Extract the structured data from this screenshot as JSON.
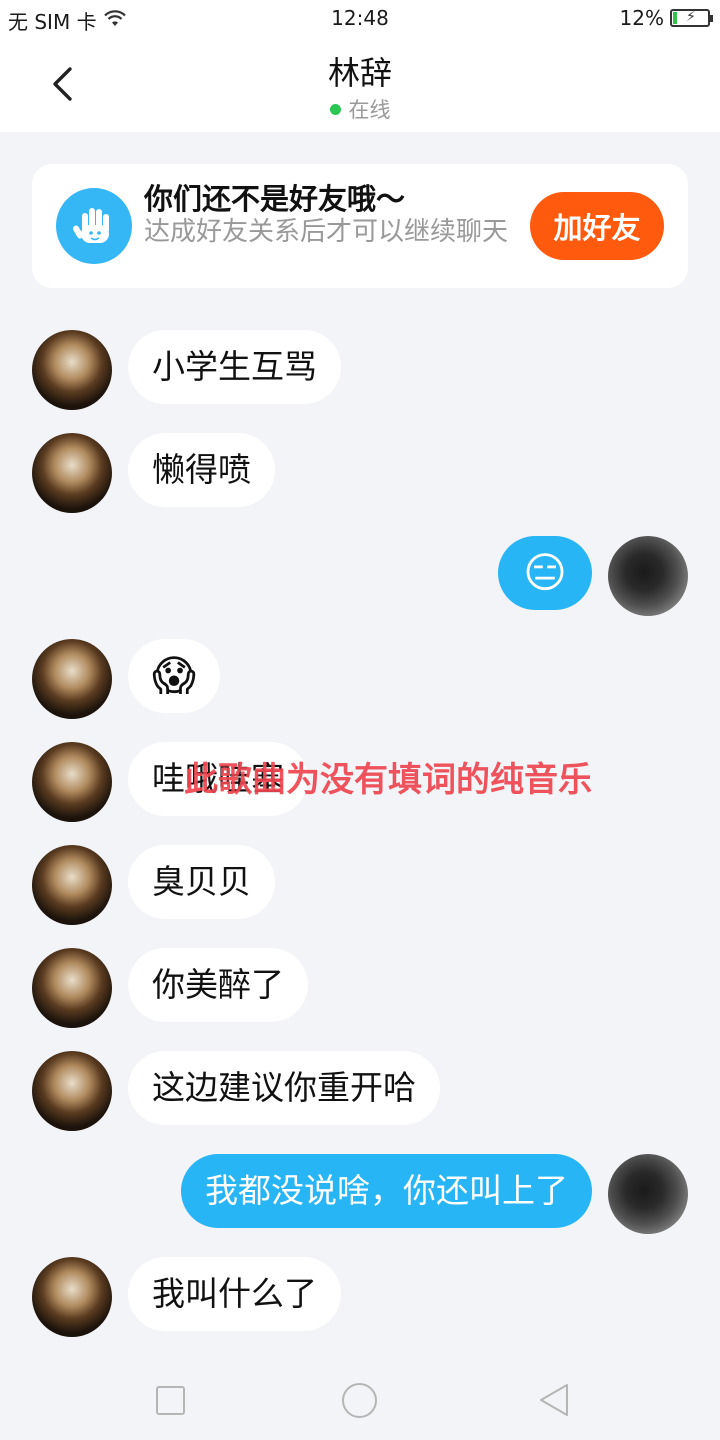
{
  "statusbar": {
    "carrier": "无 SIM 卡",
    "time": "12:48",
    "battery": "12%",
    "battery_level": 0.12
  },
  "header": {
    "title": "林辞",
    "status": "在线"
  },
  "banner": {
    "title": "你们还不是好友哦～",
    "subtitle": "达成好友关系后才可以继续聊天",
    "button": "加好友"
  },
  "overlay_text": "此歌曲为没有填词的纯音乐",
  "messages": [
    {
      "from": "them",
      "text": "小学生互骂"
    },
    {
      "from": "them",
      "text": "懒得喷"
    },
    {
      "from": "me",
      "text": "😑"
    },
    {
      "from": "them",
      "text": "😱"
    },
    {
      "from": "them",
      "text": "哇哦哇塞"
    },
    {
      "from": "them",
      "text": "臭贝贝"
    },
    {
      "from": "them",
      "text": "你美醉了"
    },
    {
      "from": "them",
      "text": "这边建议你重开哈"
    },
    {
      "from": "me",
      "text": "我都没说啥，你还叫上了"
    },
    {
      "from": "them",
      "text": "我叫什么了"
    }
  ],
  "icons": {
    "back": "chevron-left-icon",
    "wifi": "wifi-icon",
    "hand": "hand-wave-icon",
    "nav": [
      "recent-apps-icon",
      "home-icon",
      "back-triangle-icon"
    ]
  }
}
